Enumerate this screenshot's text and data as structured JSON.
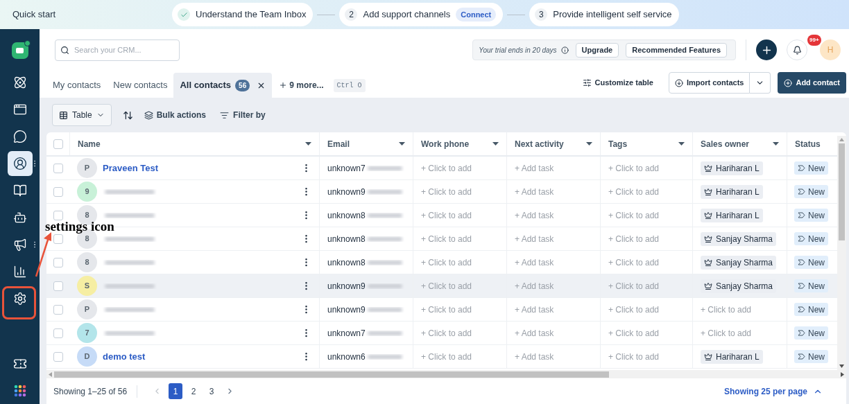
{
  "quick_start": {
    "title": "Quick start",
    "steps": [
      {
        "label": "Understand the Team Inbox",
        "done": true
      },
      {
        "label": "Add support channels",
        "done": false,
        "number": "2",
        "action": "Connect"
      },
      {
        "label": "Provide intelligent self service",
        "done": false,
        "number": "3"
      }
    ]
  },
  "sidebar": {
    "items": [
      {
        "selected": false,
        "menu": false
      },
      {
        "selected": false,
        "menu": false
      },
      {
        "selected": false,
        "menu": false
      },
      {
        "selected": true,
        "menu": true
      },
      {
        "selected": false,
        "menu": false
      },
      {
        "selected": false,
        "menu": false
      },
      {
        "selected": false,
        "menu": true
      },
      {
        "selected": false,
        "menu": false
      },
      {
        "selected": false,
        "menu": false
      }
    ]
  },
  "header": {
    "search": {
      "placeholder": "Search your CRM..."
    },
    "trial": "Your trial ends in 20 days",
    "upgrade": "Upgrade",
    "recommended": "Recommended Features",
    "notifications": "99+",
    "avatar": "H"
  },
  "tabs": [
    {
      "label": "My contacts",
      "selected": false
    },
    {
      "label": "New contacts",
      "selected": false
    },
    {
      "label": "All contacts",
      "selected": true,
      "count": "56"
    }
  ],
  "more_views": "9 more...",
  "shortcut": "Ctrl O",
  "actions": {
    "customize": "Customize table",
    "import": "Import contacts",
    "add": "Add contact"
  },
  "toolbar": {
    "view": "Table",
    "bulk": "Bulk actions",
    "filter": "Filter by"
  },
  "table": {
    "all_selected": false,
    "columns": [
      {
        "label": "Name",
        "sortable": true
      },
      {
        "label": "Email",
        "sortable": true
      },
      {
        "label": "Work phone",
        "sortable": true
      },
      {
        "label": "Next activity",
        "sortable": true
      },
      {
        "label": "Tags",
        "sortable": true
      },
      {
        "label": "Sales owner",
        "sortable": true
      },
      {
        "label": "Status",
        "sortable": false
      }
    ],
    "rows": [
      {
        "avatar": "P",
        "color": "#e5e7eb",
        "name": "Praveen Test",
        "email": "unknown7",
        "phone": "+ Click to add",
        "activity": "+ Add task",
        "tags": "+ Click to add",
        "owner": "Hariharan L",
        "status": "New",
        "hovered": false
      },
      {
        "avatar": "9",
        "color": "#c8f1d8",
        "email": "unknown9",
        "phone": "+ Click to add",
        "activity": "+ Add task",
        "tags": "+ Click to add",
        "owner": "Hariharan L",
        "status": "New",
        "hovered": false
      },
      {
        "avatar": "8",
        "color": "#e5e7eb",
        "email": "unknown8",
        "phone": "+ Click to add",
        "activity": "+ Add task",
        "tags": "+ Click to add",
        "owner": "Hariharan L",
        "status": "New",
        "hovered": false
      },
      {
        "avatar": "8",
        "color": "#e5e7eb",
        "email": "unknown8",
        "phone": "+ Click to add",
        "activity": "+ Add task",
        "tags": "+ Click to add",
        "owner": "Sanjay Sharma",
        "status": "New",
        "hovered": false
      },
      {
        "avatar": "8",
        "color": "#e5e7eb",
        "email": "unknown8",
        "phone": "+ Click to add",
        "activity": "+ Add task",
        "tags": "+ Click to add",
        "owner": "Sanjay Sharma",
        "status": "New",
        "hovered": false
      },
      {
        "avatar": "S",
        "color": "#f6eea3",
        "email": "unknown9",
        "phone": "+ Click to add",
        "activity": "+ Add task",
        "tags": "+ Click to add",
        "owner": "Sanjay Sharma",
        "status": "New",
        "hovered": true
      },
      {
        "avatar": "P",
        "color": "#e5e7eb",
        "email": "unknown9",
        "phone": "+ Click to add",
        "activity": "+ Add task",
        "tags": "+ Click to add",
        "owner_placeholder": "+ Click to add",
        "status": "New",
        "hovered": false
      },
      {
        "avatar": "7",
        "color": "#b3e5ea",
        "email": "unknown7",
        "phone": "+ Click to add",
        "activity": "+ Add task",
        "tags": "+ Click to add",
        "owner_placeholder": "+ Click to add",
        "status": "New",
        "hovered": false
      },
      {
        "avatar": "D",
        "color": "#c6dbf7",
        "name": "demo test",
        "email": "unknown6",
        "phone": "+ Click to add",
        "activity": "+ Add task",
        "tags": "+ Click to add",
        "owner": "Hariharan L",
        "status": "New",
        "hovered": false
      }
    ]
  },
  "footer": {
    "summary": "Showing 1–25 of 56",
    "pages": [
      {
        "label": "1",
        "selected": true
      },
      {
        "label": "2",
        "selected": false
      },
      {
        "label": "3",
        "selected": false
      }
    ],
    "per_page": "Showing 25 per page"
  },
  "annotation": {
    "label": "settings icon"
  }
}
